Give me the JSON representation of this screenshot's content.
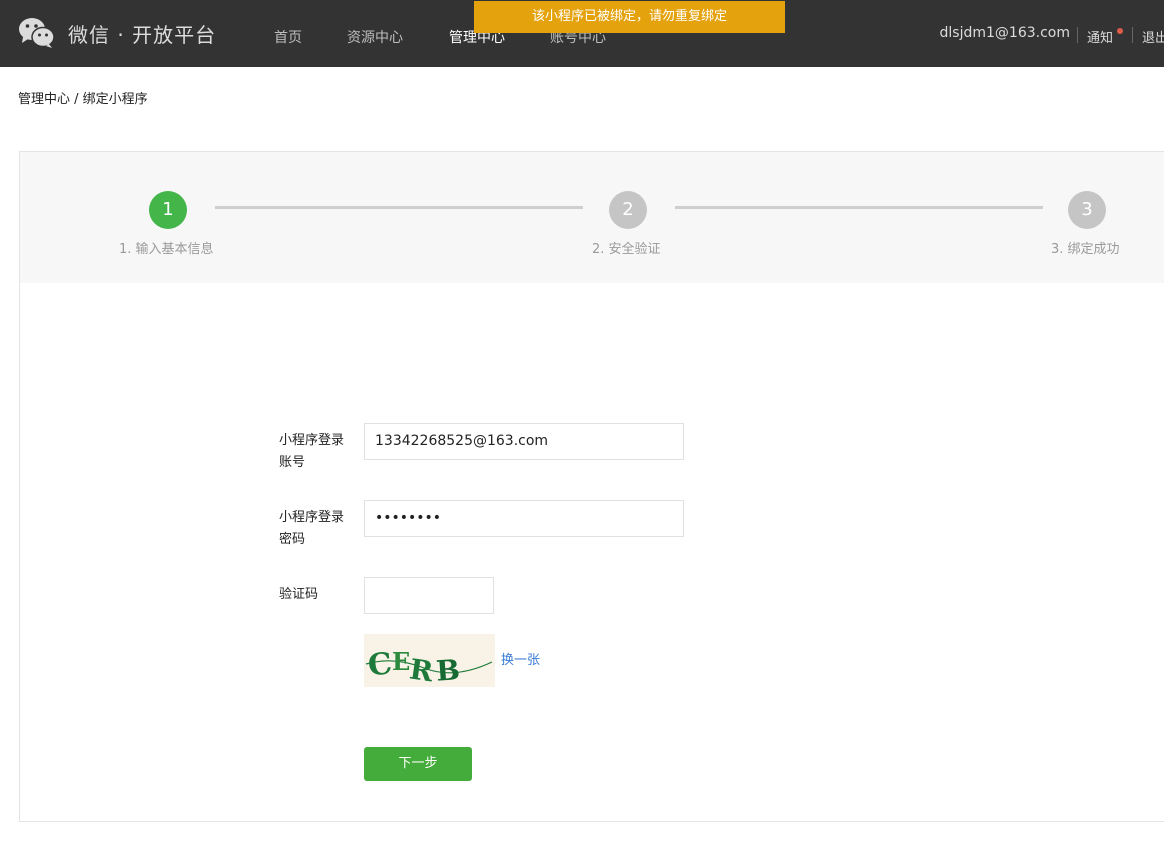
{
  "header": {
    "logo_text": "微信 · 开放平台",
    "nav": [
      {
        "label": "首页"
      },
      {
        "label": "资源中心"
      },
      {
        "label": "管理中心"
      },
      {
        "label": "账号中心"
      }
    ],
    "user_email": "dlsjdm1@163.com",
    "notify_label": "通知",
    "logout_label": "退出"
  },
  "toast": {
    "message": "该小程序已被绑定，请勿重复绑定"
  },
  "breadcrumb": "管理中心 / 绑定小程序",
  "steps": [
    {
      "number": "1",
      "label": "1. 输入基本信息",
      "state": "active"
    },
    {
      "number": "2",
      "label": "2. 安全验证",
      "state": "inactive"
    },
    {
      "number": "3",
      "label": "3. 绑定成功",
      "state": "inactive"
    }
  ],
  "form": {
    "account_label": "小程序登录账号",
    "account_value": "13342268525@163.com",
    "password_label": "小程序登录密码",
    "password_value": "••••••••",
    "captcha_label": "验证码",
    "captcha_value": "",
    "captcha_text": "CERB",
    "change_label": "换一张",
    "next_label": "下一步"
  },
  "colors": {
    "topbar": "#333333",
    "toast": "#e4a20c",
    "active_step": "#44b549",
    "inactive_step": "#c5c5c5",
    "primary_button": "#44ac3a",
    "link": "#3a7bd5"
  }
}
